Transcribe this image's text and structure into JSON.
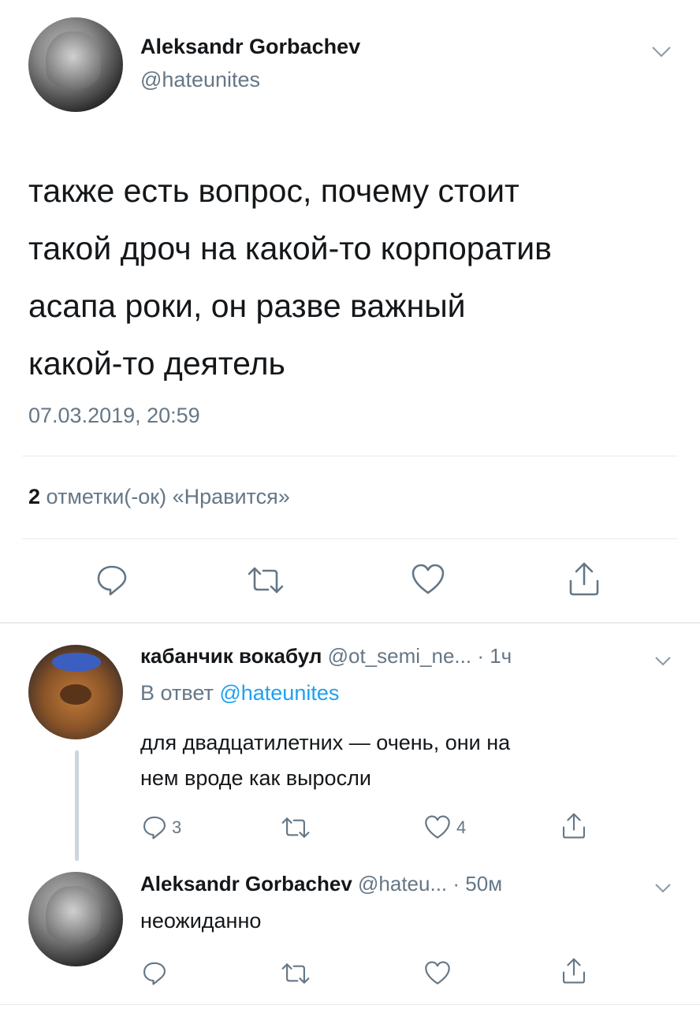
{
  "main_tweet": {
    "author_name": "Aleksandr Gorbachev",
    "handle": "@hateunites",
    "text_lines": [
      "также есть вопрос, почему стоит",
      "такой дроч на какой-то корпоратив",
      "асапа роки, он разве важный",
      "какой-то деятель"
    ],
    "timestamp": "07.03.2019, 20:59",
    "likes_count": "2",
    "likes_label": "отметки(-ок) «Нравится»"
  },
  "reply_1": {
    "author_name": "кабанчик вокабул",
    "handle": "@ot_semi_ne...",
    "time": "· 1ч",
    "reply_to_label": "В ответ",
    "reply_to_handle": "@hateunites",
    "text_lines": [
      "для двадцатилетних — очень, они на",
      "нем вроде как выросли"
    ],
    "reply_count": "3",
    "like_count": "4"
  },
  "reply_2": {
    "author_name": "Aleksandr Gorbachev",
    "handle": "@hateu...",
    "time": "· 50м",
    "text": "неожиданно"
  },
  "icons": [
    "reply-icon",
    "retweet-icon",
    "like-icon",
    "share-icon",
    "chevron-down-icon"
  ],
  "colors": {
    "accent": "#1da1f2",
    "secondary_text": "#657786",
    "divider": "#e6ecf0"
  }
}
